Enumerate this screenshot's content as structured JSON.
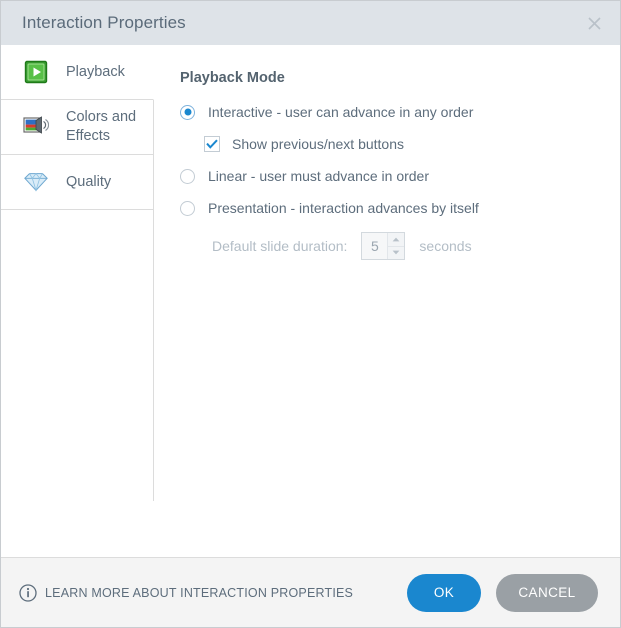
{
  "window": {
    "title": "Interaction Properties",
    "close_icon": "close-icon"
  },
  "sidebar": {
    "items": [
      {
        "label": "Playback",
        "icon": "play-button-icon",
        "selected": true
      },
      {
        "label": "Colors and Effects",
        "icon": "colors-and-effects-icon",
        "selected": false
      },
      {
        "label": "Quality",
        "icon": "diamond-icon",
        "selected": false
      }
    ]
  },
  "content": {
    "section_title": "Playback Mode",
    "options": [
      {
        "label": "Interactive - user can advance in any order",
        "selected": true
      },
      {
        "label": "Linear - user must advance in order",
        "selected": false
      },
      {
        "label": "Presentation - interaction advances by itself",
        "selected": false
      }
    ],
    "show_buttons_checkbox": {
      "label": "Show previous/next buttons",
      "checked": true
    },
    "duration": {
      "label": "Default slide duration:",
      "value": "5",
      "units": "seconds",
      "enabled": false
    }
  },
  "footer": {
    "learn_more": "LEARN MORE ABOUT INTERACTION PROPERTIES",
    "learn_more_icon": "info-icon",
    "ok_label": "OK",
    "cancel_label": "CANCEL"
  },
  "colors": {
    "titlebar_bg": "#dee3e8",
    "accent_blue": "#1a87cf",
    "cancel_gray": "#9aa0a5",
    "text_slate": "#5d6d7c",
    "disabled_gray": "#b3bdc6",
    "footer_bg": "#f4f4f4"
  }
}
